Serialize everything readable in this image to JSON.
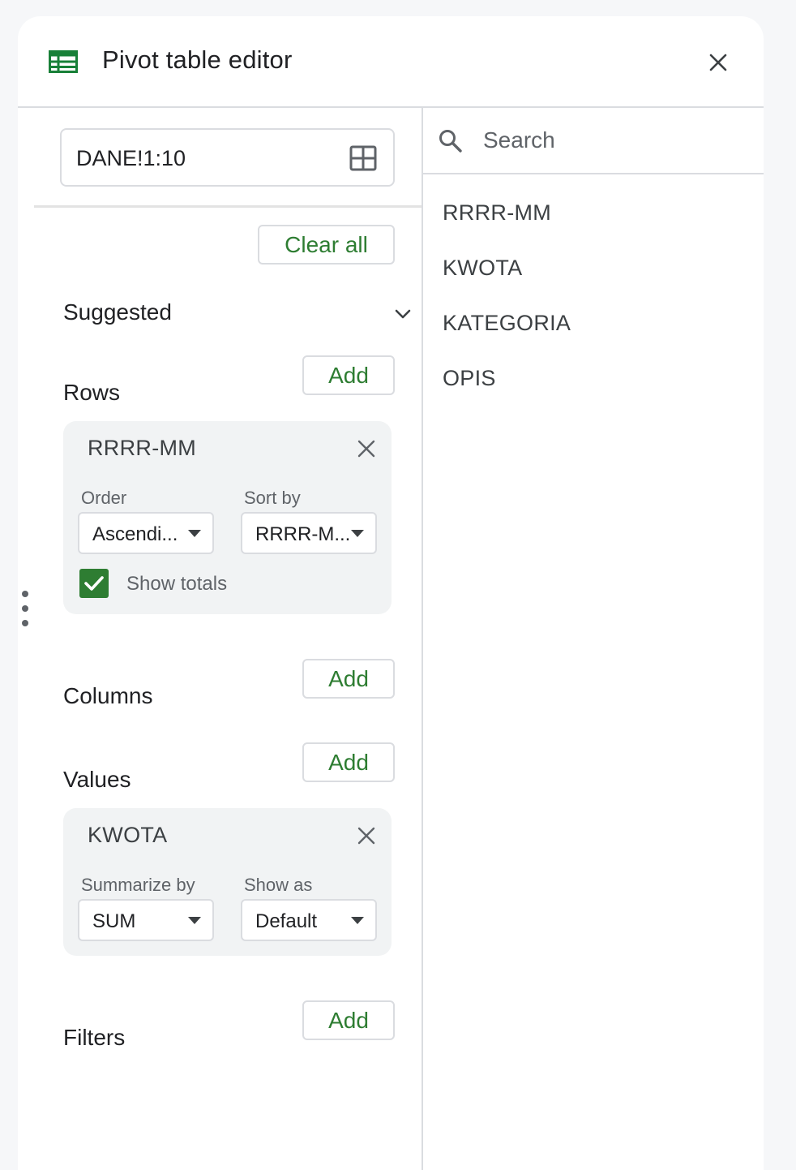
{
  "header": {
    "title": "Pivot table editor"
  },
  "range": {
    "value": "DANE!1:10"
  },
  "clear_all_label": "Clear all",
  "suggested": {
    "label": "Suggested"
  },
  "rows": {
    "label": "Rows",
    "add_label": "Add",
    "card": {
      "title": "RRRR-MM",
      "order_label": "Order",
      "order_value": "Ascendi...",
      "sort_by_label": "Sort by",
      "sort_by_value": "RRRR-M...",
      "show_totals_label": "Show totals",
      "show_totals_checked": true
    }
  },
  "columns": {
    "label": "Columns",
    "add_label": "Add"
  },
  "values": {
    "label": "Values",
    "add_label": "Add",
    "card": {
      "title": "KWOTA",
      "summarize_label": "Summarize by",
      "summarize_value": "SUM",
      "show_as_label": "Show as",
      "show_as_value": "Default"
    }
  },
  "filters": {
    "label": "Filters",
    "add_label": "Add"
  },
  "search": {
    "placeholder": "Search",
    "value": ""
  },
  "fields": [
    {
      "label": "RRRR-MM"
    },
    {
      "label": "KWOTA"
    },
    {
      "label": "KATEGORIA"
    },
    {
      "label": "OPIS"
    }
  ],
  "colors": {
    "accent": "#2e7d32",
    "border": "#dadce0",
    "card_bg": "#f1f3f4"
  }
}
